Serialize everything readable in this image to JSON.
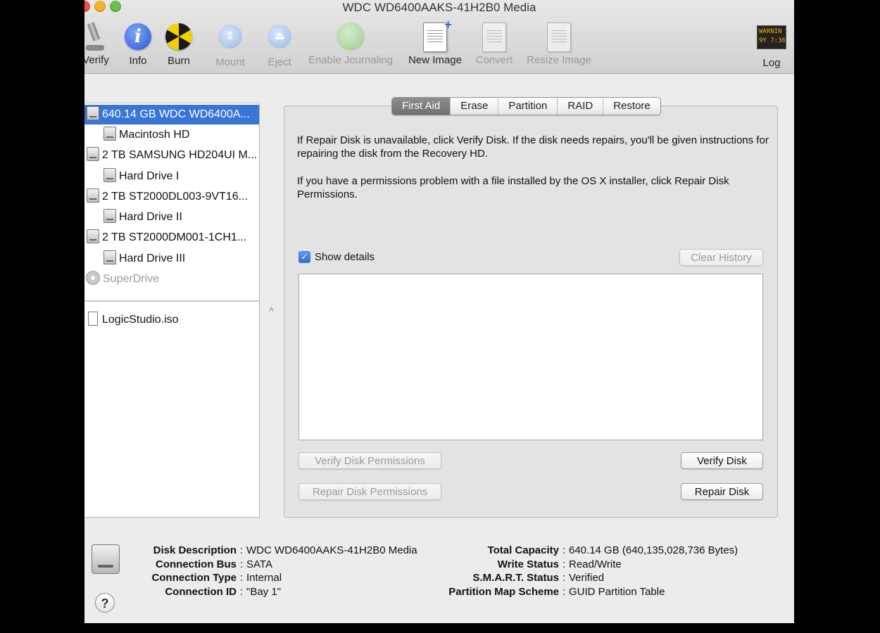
{
  "window": {
    "title": "WDC WD6400AAKS-41H2B0 Media"
  },
  "toolbar": {
    "verify": "Verify",
    "info": "Info",
    "burn": "Burn",
    "mount": "Mount",
    "eject": "Eject",
    "enable_journaling": "Enable Journaling",
    "new_image": "New Image",
    "convert": "Convert",
    "resize_image": "Resize Image",
    "log": "Log",
    "log_icon_text": "WARNIN\n9Y 7:36"
  },
  "sidebar": {
    "items": [
      {
        "label": "640.14 GB WDC WD6400A...",
        "selected": true
      },
      {
        "label": "Macintosh HD"
      },
      {
        "label": "2 TB SAMSUNG HD204UI M..."
      },
      {
        "label": "Hard Drive I"
      },
      {
        "label": "2 TB ST2000DL003-9VT16..."
      },
      {
        "label": "Hard Drive II"
      },
      {
        "label": "2 TB ST2000DM001-1CH1..."
      },
      {
        "label": "Hard Drive III"
      },
      {
        "label": "SuperDrive"
      },
      {
        "label": "LogicStudio.iso"
      }
    ]
  },
  "tabs": [
    "First Aid",
    "Erase",
    "Partition",
    "RAID",
    "Restore"
  ],
  "first_aid": {
    "para1": "If Repair Disk is unavailable, click Verify Disk. If the disk needs repairs, you'll be given instructions for repairing the disk from the Recovery HD.",
    "para2": "If you have a permissions problem with a file installed by the OS X installer, click Repair Disk Permissions.",
    "show_details": "Show details",
    "clear_history": "Clear History",
    "verify_permissions": "Verify Disk Permissions",
    "repair_permissions": "Repair Disk Permissions",
    "verify_disk": "Verify Disk",
    "repair_disk": "Repair Disk"
  },
  "disk_info": {
    "left": [
      {
        "key": "Disk Description",
        "value": "WDC WD6400AAKS-41H2B0 Media"
      },
      {
        "key": "Connection Bus",
        "value": "SATA"
      },
      {
        "key": "Connection Type",
        "value": "Internal"
      },
      {
        "key": "Connection ID",
        "value": "\"Bay 1\""
      }
    ],
    "right": [
      {
        "key": "Total Capacity",
        "value": "640.14 GB (640,135,028,736 Bytes)"
      },
      {
        "key": "Write Status",
        "value": "Read/Write"
      },
      {
        "key": "S.M.A.R.T. Status",
        "value": "Verified"
      },
      {
        "key": "Partition Map Scheme",
        "value": "GUID Partition Table"
      }
    ],
    "separator": ":"
  },
  "help": "?",
  "colors": {
    "selection": "#3875d7",
    "window_bg": "#ececec"
  }
}
